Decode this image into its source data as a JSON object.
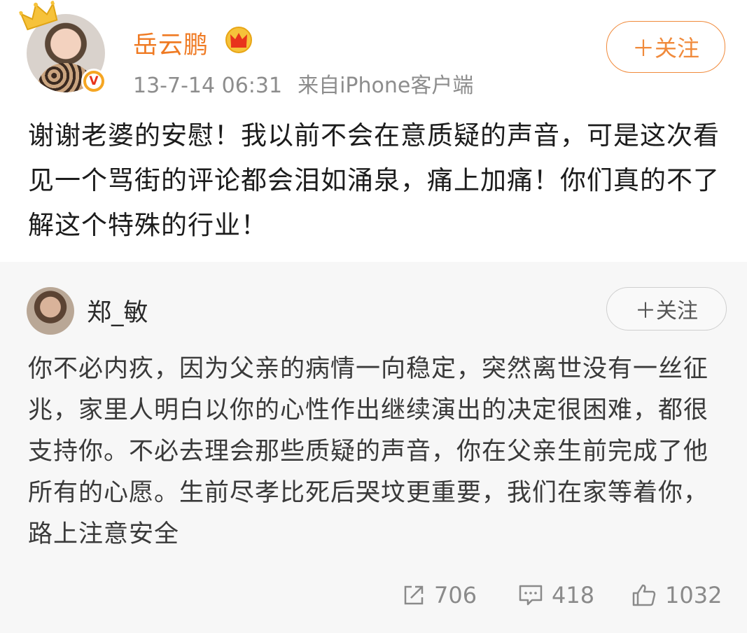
{
  "post": {
    "author": "岳云鹏",
    "timestamp": "13-7-14 06:31",
    "source": "来自iPhone客户端",
    "follow_label": "＋关注",
    "text": "谢谢老婆的安慰！我以前不会在意质疑的声音，可是这次看见一个骂街的评论都会泪如涌泉，痛上加痛！你们真的不了解这个特殊的行业！"
  },
  "retweet": {
    "author": "郑_敏",
    "follow_label": "＋关注",
    "text": "你不必内疚，因为父亲的病情一向稳定，突然离世没有一丝征兆，家里人明白以你的心性作出继续演出的决定很困难，都很支持你。不必去理会那些质疑的声音，你在父亲生前完成了他所有的心愿。生前尽孝比死后哭坟更重要，我们在家等着你，路上注意安全",
    "stats": {
      "reposts": "706",
      "comments": "418",
      "likes": "1032"
    }
  },
  "colors": {
    "username": "#ef7a23",
    "follow_accent": "#f08a3b",
    "meta_gray": "#8d8d8d",
    "repost_bg": "#f7f7f7",
    "verified": "#f5a623"
  },
  "icons": {
    "crown": "crown-icon",
    "vip": "vip-crown-icon",
    "verified": "verified-v-icon",
    "repost": "repost-icon",
    "comment": "comment-icon",
    "like": "thumbs-up-icon"
  }
}
